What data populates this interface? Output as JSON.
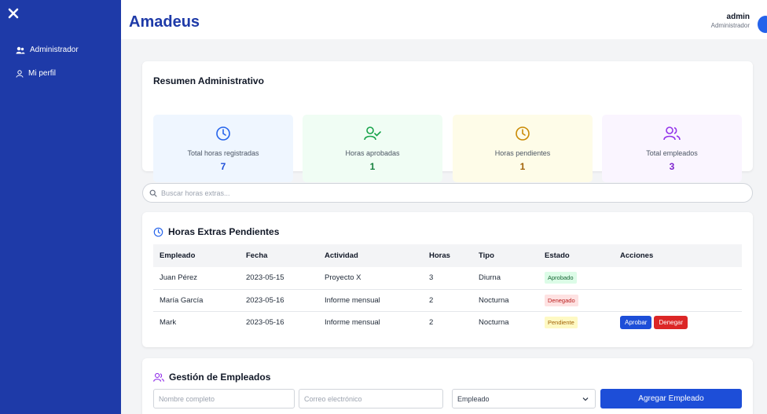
{
  "app": {
    "title": "Amadeus"
  },
  "user": {
    "name": "admin",
    "role": "Administrador"
  },
  "sidebar": {
    "items": [
      {
        "label": "Administrador",
        "icon": "users-icon"
      },
      {
        "label": "Mi perfil",
        "icon": "user-icon"
      }
    ]
  },
  "summary": {
    "title": "Resumen Administrativo",
    "stats": [
      {
        "label": "Total horas registradas",
        "value": "7",
        "icon": "clock-icon",
        "color": "#2563eb",
        "bg": "#eff6ff"
      },
      {
        "label": "Horas aprobadas",
        "value": "1",
        "icon": "user-check-icon",
        "color": "#16a34a",
        "bg": "#f0fdf4"
      },
      {
        "label": "Horas pendientes",
        "value": "1",
        "icon": "clock-icon",
        "color": "#ca8a04",
        "bg": "#fefce8"
      },
      {
        "label": "Total empleados",
        "value": "3",
        "icon": "users-icon",
        "color": "#9333ea",
        "bg": "#faf5ff"
      }
    ]
  },
  "search": {
    "placeholder": "Buscar horas extras..."
  },
  "pending": {
    "title": "Horas Extras Pendientes",
    "columns": [
      "Empleado",
      "Fecha",
      "Actividad",
      "Horas",
      "Tipo",
      "Estado",
      "Acciones"
    ],
    "rows": [
      {
        "empleado": "Juan Pérez",
        "fecha": "2023-05-15",
        "actividad": "Proyecto X",
        "horas": "3",
        "tipo": "Diurna",
        "estado": "Aprobado"
      },
      {
        "empleado": "María García",
        "fecha": "2023-05-16",
        "actividad": "Informe mensual",
        "horas": "2",
        "tipo": "Nocturna",
        "estado": "Denegado"
      },
      {
        "empleado": "Mark",
        "fecha": "2023-05-16",
        "actividad": "Informe mensual",
        "horas": "2",
        "tipo": "Nocturna",
        "estado": "Pendiente"
      }
    ],
    "approve_label": "Aprobar",
    "deny_label": "Denegar"
  },
  "employees": {
    "title": "Gestión de Empleados",
    "name_placeholder": "Nombre completo",
    "email_placeholder": "Correo electrónico",
    "role_selected": "Empleado",
    "add_label": "Agregar Empleado"
  },
  "colors": {
    "sidebar": "#1e3aa8",
    "accent": "#1d4ed8",
    "danger": "#dc2626"
  }
}
